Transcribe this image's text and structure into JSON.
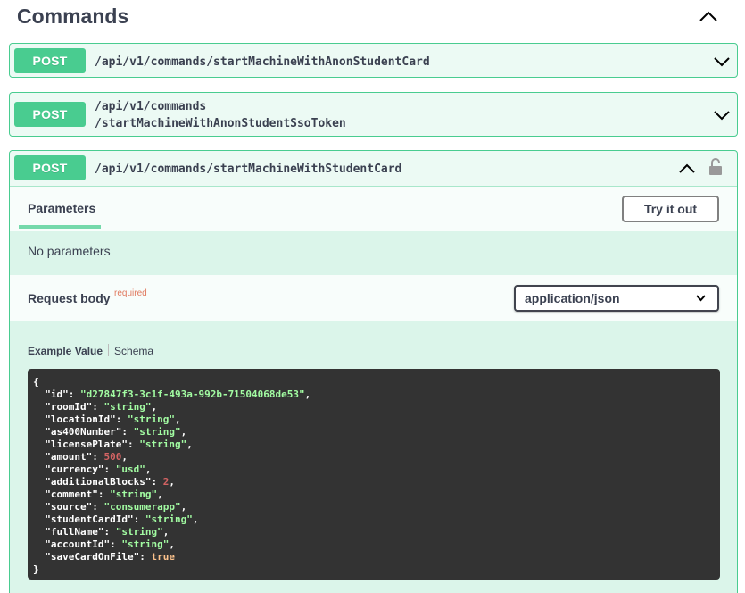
{
  "section": {
    "title": "Commands"
  },
  "operations": [
    {
      "method": "POST",
      "path": "/api/v1/commands/startMachineWithAnonStudentCard"
    },
    {
      "method": "POST",
      "path_line1": "/api/v1/commands",
      "path_line2": "/startMachineWithAnonStudentSsoToken"
    },
    {
      "method": "POST",
      "path": "/api/v1/commands/startMachineWithStudentCard"
    }
  ],
  "expanded": {
    "parameters_tab": "Parameters",
    "try_button": "Try it out",
    "no_params": "No parameters",
    "request_body_label": "Request body",
    "required_label": "required",
    "content_type": "application/json",
    "example_tab": "Example Value",
    "schema_tab": "Schema"
  },
  "example_json": {
    "open": "{",
    "close": "}",
    "fields": [
      {
        "key": "\"id\"",
        "value": "\"d27847f3-3c1f-493a-992b-71504068de53\"",
        "kind": "s"
      },
      {
        "key": "\"roomId\"",
        "value": "\"string\"",
        "kind": "s"
      },
      {
        "key": "\"locationId\"",
        "value": "\"string\"",
        "kind": "s"
      },
      {
        "key": "\"as400Number\"",
        "value": "\"string\"",
        "kind": "s"
      },
      {
        "key": "\"licensePlate\"",
        "value": "\"string\"",
        "kind": "s"
      },
      {
        "key": "\"amount\"",
        "value": "500",
        "kind": "n"
      },
      {
        "key": "\"currency\"",
        "value": "\"usd\"",
        "kind": "s"
      },
      {
        "key": "\"additionalBlocks\"",
        "value": "2",
        "kind": "n"
      },
      {
        "key": "\"comment\"",
        "value": "\"string\"",
        "kind": "s"
      },
      {
        "key": "\"source\"",
        "value": "\"consumerapp\"",
        "kind": "s"
      },
      {
        "key": "\"studentCardId\"",
        "value": "\"string\"",
        "kind": "s"
      },
      {
        "key": "\"fullName\"",
        "value": "\"string\"",
        "kind": "s"
      },
      {
        "key": "\"accountId\"",
        "value": "\"string\"",
        "kind": "s"
      },
      {
        "key": "\"saveCardOnFile\"",
        "value": "true",
        "kind": "b"
      }
    ]
  },
  "colors": {
    "post_green": "#49cc90",
    "code_bg": "#333333",
    "string": "#a2fca2",
    "number": "#d36363",
    "boolean": "#fcc28c"
  },
  "icons": [
    "chevron-up-icon",
    "chevron-down-icon",
    "unlock-icon"
  ]
}
